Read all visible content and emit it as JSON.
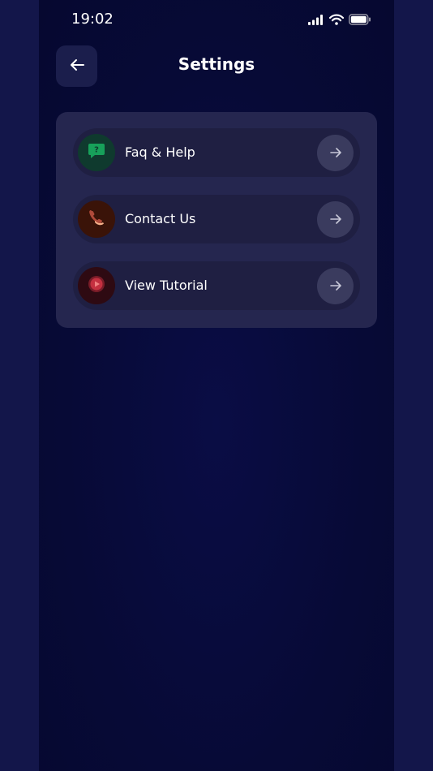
{
  "status_bar": {
    "time": "19:02"
  },
  "header": {
    "title": "Settings"
  },
  "menu": {
    "items": [
      {
        "label": "Faq & Help",
        "icon": "help-chat-icon",
        "icon_bg": "#0f3a2e",
        "icon_color": "#17a05a"
      },
      {
        "label": "Contact Us",
        "icon": "phone-icon",
        "icon_bg": "#3a1308",
        "icon_color": "#f08a5a"
      },
      {
        "label": "View Tutorial",
        "icon": "play-icon",
        "icon_bg": "#2e0a12",
        "icon_color": "#e04848"
      }
    ]
  },
  "colors": {
    "background": "#070a36",
    "side_background": "#13164a",
    "card": "#25264f",
    "row": "#1f1f42",
    "arrow_button": "#3a3b5e"
  }
}
